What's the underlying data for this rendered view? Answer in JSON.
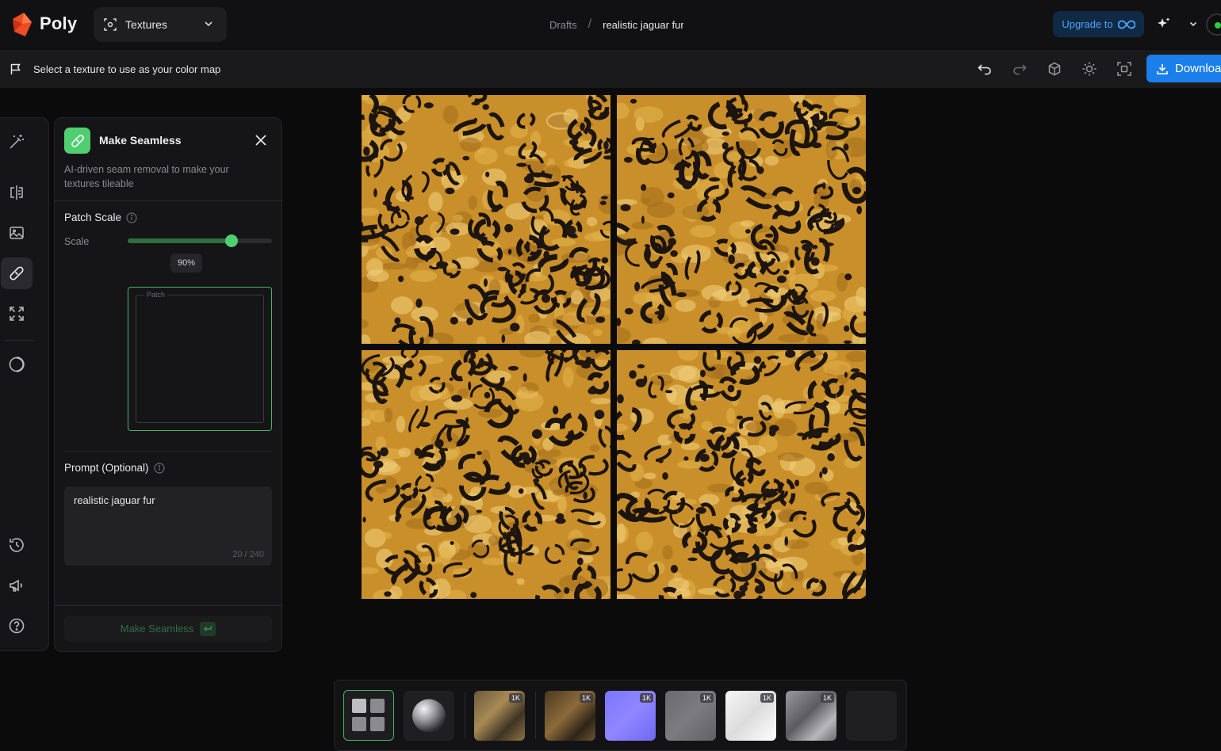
{
  "app": {
    "brand": "Poly",
    "mode": "Textures"
  },
  "breadcrumb": {
    "parent": "Drafts",
    "separator": "/",
    "current": "realistic jaguar fur"
  },
  "header": {
    "upgrade_label": "Upgrade to"
  },
  "toolbar": {
    "instruction": "Select a texture to use as your color map",
    "download_label": "Download"
  },
  "panel": {
    "title": "Make Seamless",
    "description": "AI-driven seam removal to make your textures tileable",
    "patch_heading": "Patch Scale",
    "scale_label": "Scale",
    "scale_value": 0.9,
    "scale_display": "90%",
    "patch_label": "Patch",
    "prompt_heading": "Prompt (Optional)",
    "prompt_value": "realistic jaguar fur",
    "prompt_count": "20 / 240",
    "action_label": "Make Seamless"
  },
  "canvas": {
    "tiles": [
      "tile-1",
      "tile-2",
      "tile-3",
      "tile-4"
    ]
  },
  "maps": [
    {
      "name": "color-map",
      "res": "1K"
    },
    {
      "name": "height-map",
      "res": "1K"
    },
    {
      "name": "normal-map",
      "res": "1K"
    },
    {
      "name": "roughness-map",
      "res": "1K"
    },
    {
      "name": "ao-map",
      "res": "1K"
    },
    {
      "name": "metallic-map",
      "res": "1K"
    }
  ],
  "colors": {
    "accent_green": "#4fcf70",
    "download_blue": "#1c7eea",
    "upgrade_text": "#4ea3ff"
  }
}
